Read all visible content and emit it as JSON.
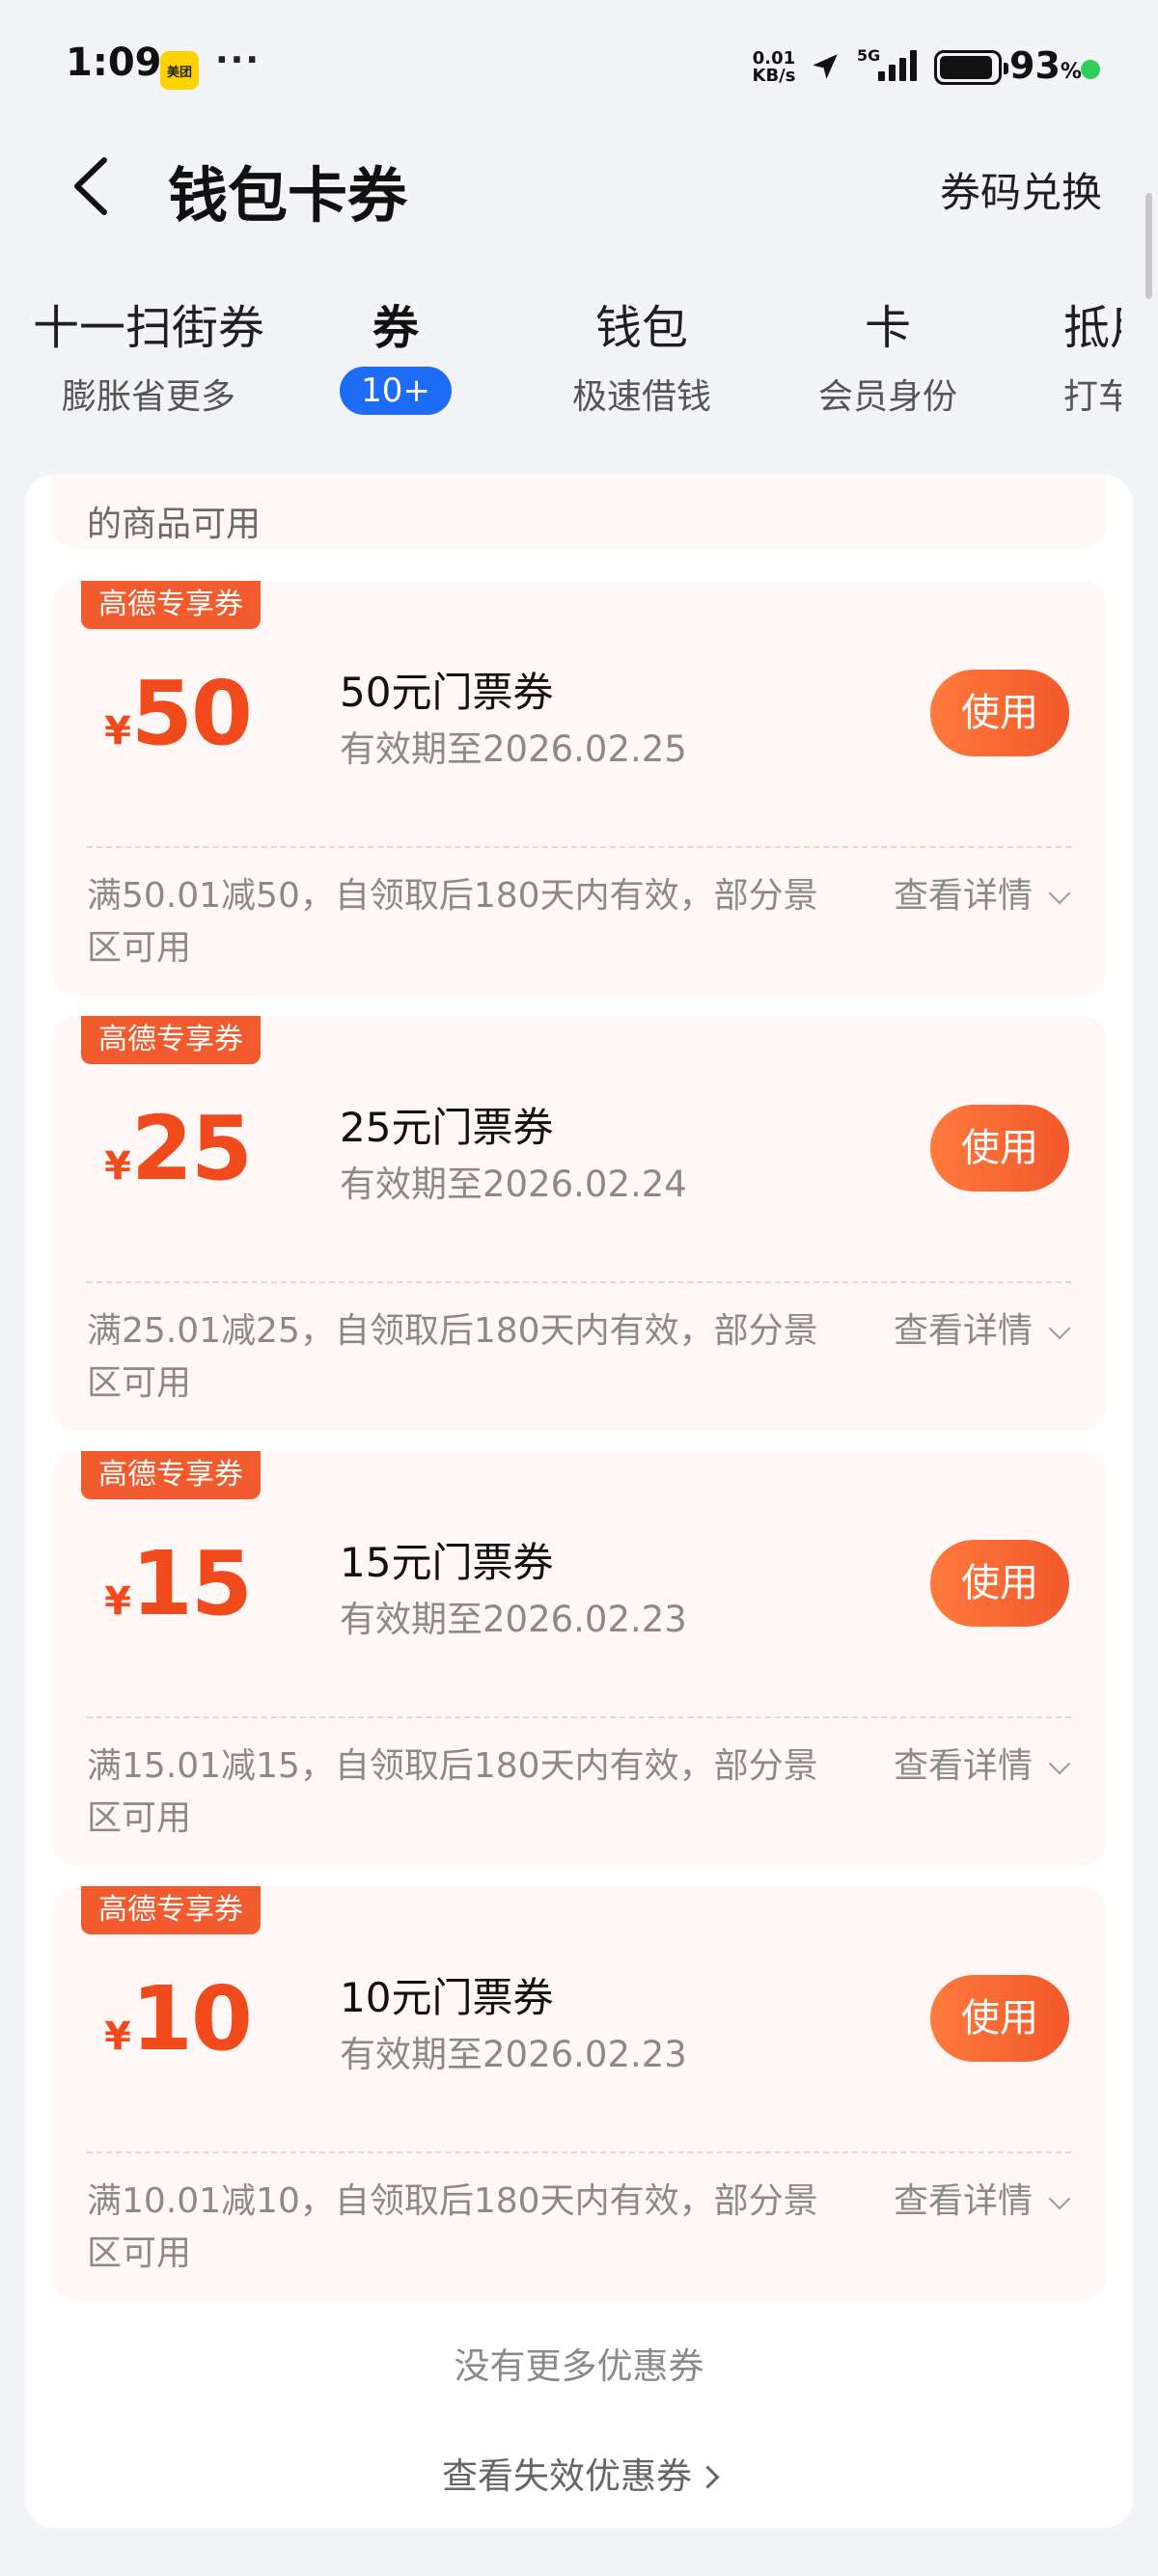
{
  "status_bar": {
    "time": "1:09",
    "app_badge": "美团",
    "dots": "···",
    "net_speed_value": "0.01",
    "net_speed_unit": "KB/s",
    "network": "5G",
    "battery_percent": "93",
    "battery_level": 0.93,
    "battery_unit": "%"
  },
  "header": {
    "title": "钱包卡券",
    "redeem_label": "券码兑换"
  },
  "tabs": [
    {
      "main": "十一扫街券",
      "sub": "膨胀省更多"
    },
    {
      "main": "券",
      "badge": "10+"
    },
    {
      "main": "钱包",
      "sub": "极速借钱"
    },
    {
      "main": "卡",
      "sub": "会员身份"
    },
    {
      "main": "抵用",
      "sub": "打车"
    }
  ],
  "partial_coupon_text": "的商品可用",
  "coupons": [
    {
      "tag": "高德专享券",
      "currency": "¥",
      "amount": "50",
      "title": "50元门票券",
      "expiry": "有效期至2026.02.25",
      "use_label": "使用",
      "rules": "满50.01减50，自领取后180天内有效，部分景区可用",
      "detail_label": "查看详情"
    },
    {
      "tag": "高德专享券",
      "currency": "¥",
      "amount": "25",
      "title": "25元门票券",
      "expiry": "有效期至2026.02.24",
      "use_label": "使用",
      "rules": "满25.01减25，自领取后180天内有效，部分景区可用",
      "detail_label": "查看详情"
    },
    {
      "tag": "高德专享券",
      "currency": "¥",
      "amount": "15",
      "title": "15元门票券",
      "expiry": "有效期至2026.02.23",
      "use_label": "使用",
      "rules": "满15.01减15，自领取后180天内有效，部分景区可用",
      "detail_label": "查看详情"
    },
    {
      "tag": "高德专享券",
      "currency": "¥",
      "amount": "10",
      "title": "10元门票券",
      "expiry": "有效期至2026.02.23",
      "use_label": "使用",
      "rules": "满10.01减10，自领取后180天内有效，部分景区可用",
      "detail_label": "查看详情"
    }
  ],
  "footer": {
    "no_more": "没有更多优惠券",
    "expired_link": "查看失效优惠券"
  },
  "colors": {
    "accent_orange": "#f25b2e",
    "active_tab_blue": "#1e6cf5",
    "coupon_bg": "#fff8f6",
    "page_bg": "#f3f4f7"
  }
}
